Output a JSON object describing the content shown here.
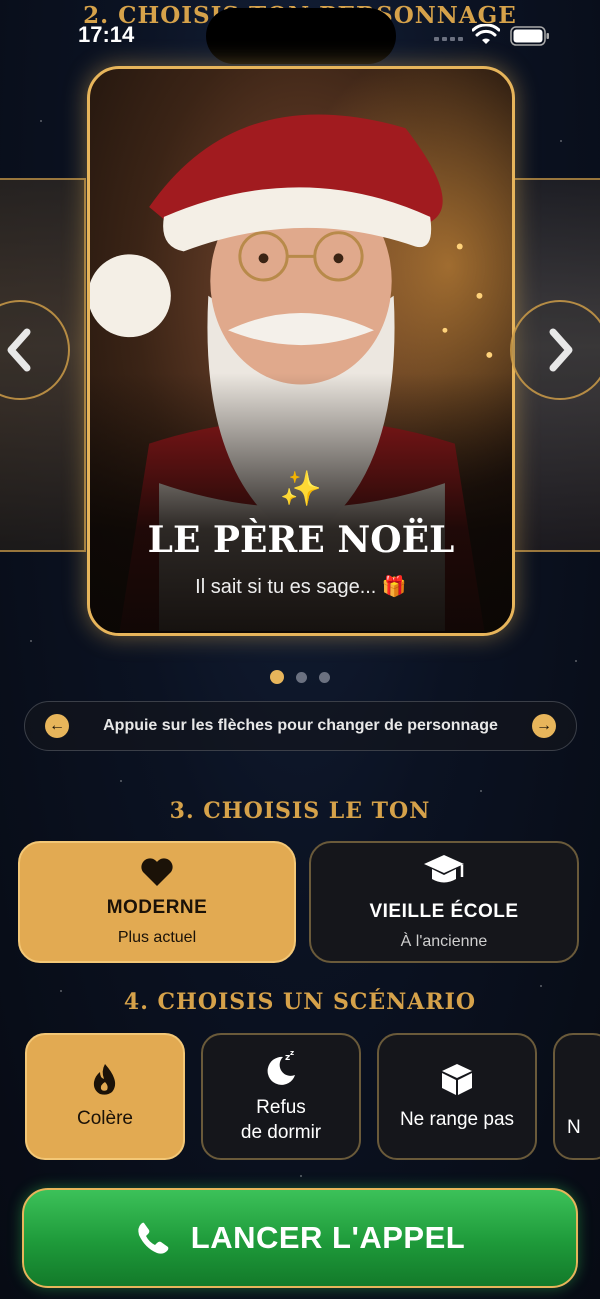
{
  "status_bar": {
    "time": "17:14"
  },
  "sections": {
    "character_partial": "2. CHOISIS TON PERSONNAGE",
    "tone": "3. CHOISIS LE TON",
    "scenario": "4. CHOISIS UN SCÉNARIO"
  },
  "character": {
    "name": "LE PÈRE NOËL",
    "tagline": "Il sait si tu es sage... 🎁",
    "sparkle_icon": "sparkles-icon",
    "page_index": 1,
    "page_count": 3
  },
  "hint": {
    "text": "Appuie sur les flèches pour changer de personnage"
  },
  "tones": [
    {
      "title": "MODERNE",
      "subtitle": "Plus actuel",
      "icon": "heart-icon",
      "selected": true
    },
    {
      "title": "VIEILLE ÉCOLE",
      "subtitle": "À l'ancienne",
      "icon": "graduation-cap-icon",
      "selected": false
    }
  ],
  "scenarios": [
    {
      "label": "Colère",
      "icon": "flame-icon",
      "selected": true
    },
    {
      "label": "Refus de dormir",
      "line1": "Refus",
      "line2": "de dormir",
      "icon": "sleep-moon-icon",
      "selected": false
    },
    {
      "label": "Ne range pas",
      "icon": "box-icon",
      "selected": false
    },
    {
      "label_partial": "N",
      "selected": false
    }
  ],
  "call_button": {
    "label": "LANCER L'APPEL",
    "icon": "phone-icon"
  },
  "colors": {
    "gold": "#e7b55b",
    "green": "#1e9a3a",
    "background": "#0b1222"
  }
}
